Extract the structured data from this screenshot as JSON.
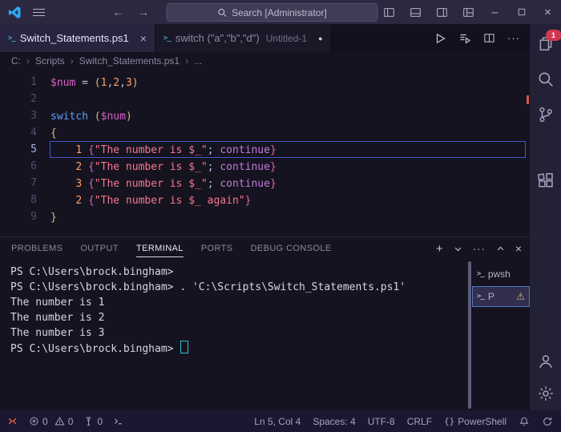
{
  "title_bar": {
    "search_text": "Search [Administrator]"
  },
  "tab_bar": {
    "tabs": [
      {
        "label": "Switch_Statements.ps1",
        "active": true,
        "dirty": false
      },
      {
        "label": "switch (\"a\",\"b\",\"d\")",
        "hint": "Untitled-1",
        "active": false,
        "dirty": true
      }
    ]
  },
  "breadcrumb": {
    "items": [
      "C:",
      "Scripts",
      "Switch_Statements.ps1",
      "..."
    ]
  },
  "editor": {
    "active_line": 5,
    "token_colors": {
      "var": "#d760c8",
      "num": "#ff9e64",
      "str": "#f7768e",
      "kw": "#5c9cf5",
      "kw2": "#c678dd",
      "brk": "#d7ba7d",
      "pbr": "#d767a8",
      "fg": "#bcc3e6"
    },
    "lines": [
      {
        "num": 1,
        "tokens": [
          [
            "var",
            "$num"
          ],
          [
            "fg",
            " = "
          ],
          [
            "brk",
            "("
          ],
          [
            "num",
            "1"
          ],
          [
            "fg",
            ","
          ],
          [
            "num",
            "2"
          ],
          [
            "fg",
            ","
          ],
          [
            "num",
            "3"
          ],
          [
            "brk",
            ")"
          ]
        ]
      },
      {
        "num": 2,
        "tokens": []
      },
      {
        "num": 3,
        "tokens": [
          [
            "kw",
            "switch"
          ],
          [
            "fg",
            " "
          ],
          [
            "brk",
            "("
          ],
          [
            "var",
            "$num"
          ],
          [
            "brk",
            ")"
          ]
        ]
      },
      {
        "num": 4,
        "tokens": [
          [
            "brk",
            "{"
          ]
        ]
      },
      {
        "num": 5,
        "tokens": [
          [
            "fg",
            "    "
          ],
          [
            "num",
            "1"
          ],
          [
            "fg",
            " "
          ],
          [
            "pbr",
            "{"
          ],
          [
            "str",
            "\"The number is $_\""
          ],
          [
            "fg",
            "; "
          ],
          [
            "kw2",
            "continue"
          ],
          [
            "pbr",
            "}"
          ]
        ]
      },
      {
        "num": 6,
        "tokens": [
          [
            "fg",
            "    "
          ],
          [
            "num",
            "2"
          ],
          [
            "fg",
            " "
          ],
          [
            "pbr",
            "{"
          ],
          [
            "str",
            "\"The number is $_\""
          ],
          [
            "fg",
            "; "
          ],
          [
            "kw2",
            "continue"
          ],
          [
            "pbr",
            "}"
          ]
        ]
      },
      {
        "num": 7,
        "tokens": [
          [
            "fg",
            "    "
          ],
          [
            "num",
            "3"
          ],
          [
            "fg",
            " "
          ],
          [
            "pbr",
            "{"
          ],
          [
            "str",
            "\"The number is $_\""
          ],
          [
            "fg",
            "; "
          ],
          [
            "kw2",
            "continue"
          ],
          [
            "pbr",
            "}"
          ]
        ]
      },
      {
        "num": 8,
        "tokens": [
          [
            "fg",
            "    "
          ],
          [
            "num",
            "2"
          ],
          [
            "fg",
            " "
          ],
          [
            "pbr",
            "{"
          ],
          [
            "str",
            "\"The number is $_ again\""
          ],
          [
            "pbr",
            "}"
          ]
        ]
      },
      {
        "num": 9,
        "tokens": [
          [
            "brk",
            "}"
          ]
        ]
      }
    ]
  },
  "panel": {
    "tabs": [
      {
        "label": "PROBLEMS",
        "active": false
      },
      {
        "label": "OUTPUT",
        "active": false
      },
      {
        "label": "TERMINAL",
        "active": true
      },
      {
        "label": "PORTS",
        "active": false
      },
      {
        "label": "DEBUG CONSOLE",
        "active": false
      }
    ],
    "terminal": {
      "cursor_line_index": 5,
      "lines": [
        "PS C:\\Users\\brock.bingham> ",
        "PS C:\\Users\\brock.bingham> . 'C:\\Scripts\\Switch_Statements.ps1'",
        "The number is 1",
        "The number is 2",
        "The number is 3",
        "PS C:\\Users\\brock.bingham> "
      ]
    },
    "terminal_tabs": [
      {
        "label": "pwsh",
        "selected": false,
        "warning": false
      },
      {
        "label": "P",
        "selected": true,
        "warning": true
      }
    ]
  },
  "activity_bar": {
    "badge": "1"
  },
  "status_bar": {
    "errors": "0",
    "warnings": "0",
    "ports": "0",
    "line_col": "Ln 5, Col 4",
    "spaces": "Spaces: 4",
    "encoding": "UTF-8",
    "eol": "CRLF",
    "language_icon": "{}",
    "language": "PowerShell"
  },
  "colors": {
    "current_line_border": "#4356c8",
    "badge_background": "#cf3852",
    "remote_icon": "#e05a47",
    "terminal_cursor": "#2fc2d4",
    "warning_yellow": "#d7ba7d",
    "ps_icon_blue": "#4ea3d8",
    "logo_blue": "#2fa8f0"
  }
}
